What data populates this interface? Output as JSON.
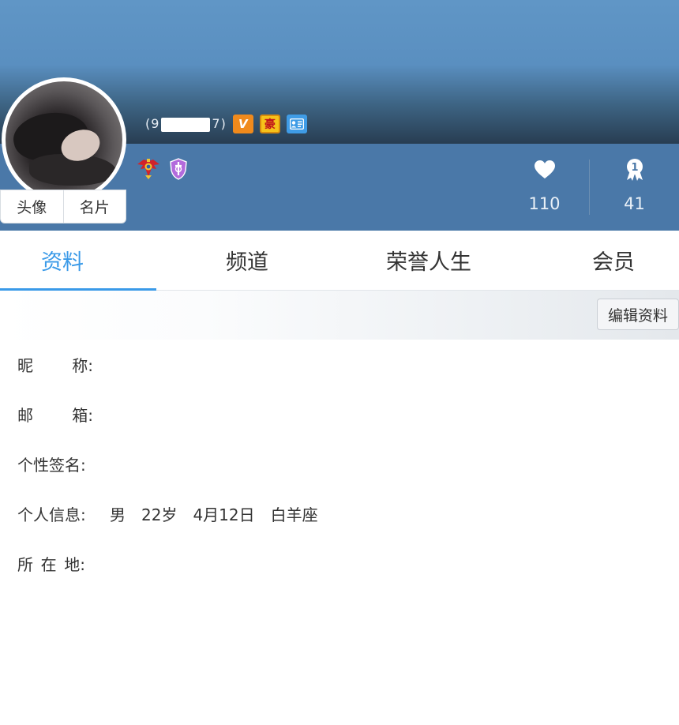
{
  "header": {
    "user_id_prefix": "(9",
    "user_id_suffix": "7)",
    "badges": [
      {
        "name": "vip-v-badge",
        "text": "V",
        "color": "#f08a1c"
      },
      {
        "name": "hao-badge",
        "text": "豪",
        "color": "#f6c21a"
      },
      {
        "name": "card-badge",
        "text": "▤",
        "color": "#3f9ce6"
      }
    ],
    "medals": [
      "eagle-medal-icon",
      "shield-medal-icon"
    ],
    "avatar_tabs": {
      "avatar": "头像",
      "card": "名片"
    },
    "stats": {
      "likes": "110",
      "honors": "41"
    }
  },
  "tabs": [
    {
      "label": "资料",
      "active": true
    },
    {
      "label": "频道",
      "active": false
    },
    {
      "label": "荣誉人生",
      "active": false
    },
    {
      "label": "会员",
      "active": false
    }
  ],
  "edit_button": "编辑资料",
  "profile": {
    "nickname": {
      "label_a": "昵",
      "label_b": "称:",
      "value": ""
    },
    "email": {
      "label_a": "邮",
      "label_b": "箱:",
      "value": ""
    },
    "signature": {
      "label": "个性签名:",
      "value": ""
    },
    "personal": {
      "label": "个人信息:",
      "gender": "男",
      "age": "22岁",
      "birthday": "4月12日",
      "zodiac": "白羊座"
    },
    "location": {
      "label_a": "所",
      "label_b": "在",
      "label_c": "地:",
      "value": ""
    }
  },
  "colors": {
    "accent": "#3a9ae8",
    "header_blue": "#4a78a8"
  }
}
